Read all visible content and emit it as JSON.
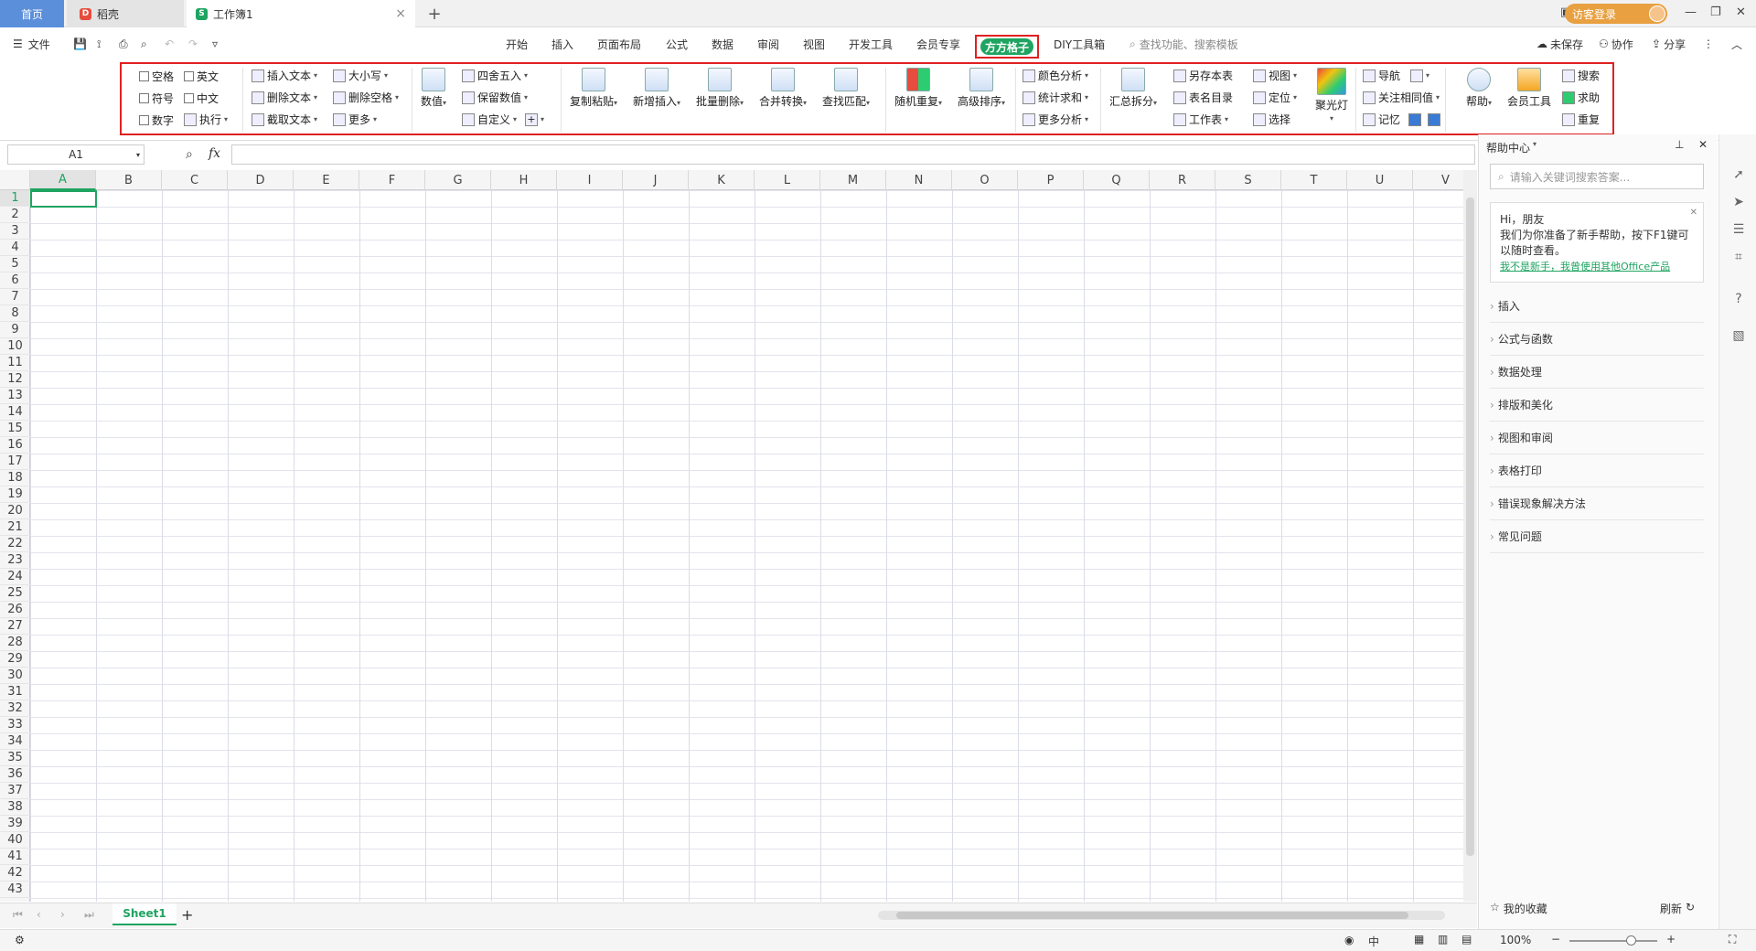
{
  "tabs": {
    "home": "首页",
    "docer": "稻壳",
    "workbook": "工作簿1",
    "add": "+",
    "close": "×"
  },
  "login": {
    "label": "访客登录"
  },
  "menu": {
    "file": "文件",
    "items": [
      "开始",
      "插入",
      "页面布局",
      "公式",
      "数据",
      "审阅",
      "视图",
      "开发工具",
      "会员专享"
    ],
    "active": "方方格子",
    "diy": "DIY工具箱",
    "search": "查找功能、搜索模板",
    "unsaved": "未保存",
    "collab": "协作",
    "share": "分享"
  },
  "ribbon": {
    "cb1": "空格",
    "cb2": "英文",
    "cb3": "符号",
    "cb4": "中文",
    "cb5": "数字",
    "exec": "执行",
    "insert_text": "插入文本",
    "delete_text": "删除文本",
    "extract_text": "截取文本",
    "case": "大小写",
    "del_space": "删除空格",
    "more": "更多",
    "numeric": "数值",
    "round": "四舍五入",
    "keep_num": "保留数值",
    "custom": "自定义",
    "copy_paste": "复制粘贴",
    "new_insert": "新增插入",
    "batch_delete": "批量删除",
    "merge_convert": "合并转换",
    "find_match": "查找匹配",
    "random_repeat": "随机重复",
    "adv_sort": "高级排序",
    "color_analysis": "颜色分析",
    "stat_sum": "统计求和",
    "more_analysis": "更多分析",
    "summary_split": "汇总拆分",
    "save_sheet": "另存本表",
    "sheet_dir": "表名目录",
    "worksheet": "工作表",
    "view": "视图",
    "locate": "定位",
    "select": "选择",
    "spotlight": "聚光灯",
    "nav": "导航",
    "focus_same": "关注相同值",
    "memo": "记忆",
    "help": "帮助",
    "member_tool": "会员工具",
    "search": "搜索",
    "ask": "求助",
    "repeat": "重复"
  },
  "formula": {
    "namebox": "A1",
    "fx": "fx"
  },
  "columns": [
    "A",
    "B",
    "C",
    "D",
    "E",
    "F",
    "G",
    "H",
    "I",
    "J",
    "K",
    "L",
    "M",
    "N",
    "O",
    "P",
    "Q",
    "R",
    "S",
    "T",
    "U",
    "V"
  ],
  "rows": [
    "1",
    "2",
    "3",
    "4",
    "5",
    "6",
    "7",
    "8",
    "9",
    "10",
    "11",
    "12",
    "13",
    "14",
    "15",
    "16",
    "17",
    "18",
    "19",
    "20",
    "21",
    "22",
    "23",
    "24",
    "25",
    "26",
    "27",
    "28",
    "29",
    "30",
    "31",
    "32",
    "33",
    "34",
    "35",
    "36",
    "37",
    "38",
    "39",
    "40",
    "41",
    "42",
    "43"
  ],
  "sheet": {
    "name": "Sheet1",
    "add": "+"
  },
  "status": {
    "zoom": "100%",
    "ime": "中"
  },
  "help": {
    "title": "帮助中心",
    "search_placeholder": "请输入关键词搜索答案...",
    "greeting": "Hi，朋友",
    "tip": "我们为你准备了新手帮助，按下F1键可以随时查看。",
    "link": "我不是新手，我曾使用其他Office产品",
    "categories": [
      "插入",
      "公式与函数",
      "数据处理",
      "排版和美化",
      "视图和审阅",
      "表格打印",
      "错误现象解决方法",
      "常见问题"
    ],
    "favorites": "我的收藏",
    "refresh": "刷新"
  },
  "colors": {
    "accent": "#1fa461",
    "highlight": "#e02020",
    "home_tab": "#5b8fd9",
    "login": "#e8a040"
  }
}
